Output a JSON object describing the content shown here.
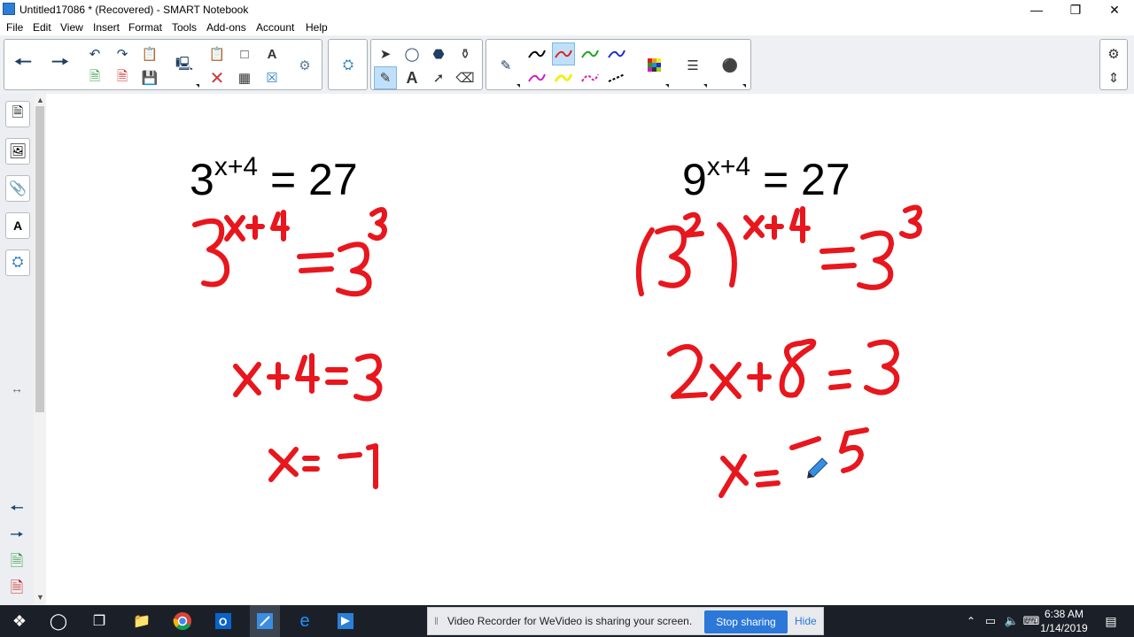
{
  "window": {
    "title": "Untitled17086 * (Recovered) - SMART Notebook",
    "minimize_icon": "minimize-icon",
    "restore_icon": "restore-icon",
    "close_icon": "close-icon"
  },
  "menu": [
    "File",
    "Edit",
    "View",
    "Insert",
    "Format",
    "Tools",
    "Add-ons",
    "Account",
    "Help"
  ],
  "toolbar": {
    "icons": [
      "back-arrow-icon",
      "forward-arrow-icon",
      "undo-icon",
      "redo-icon",
      "paste-page-icon",
      "add-page-icon",
      "delete-page-icon",
      "save-icon",
      "screen-capture-icon",
      "paste-icon",
      "delete-icon",
      "display-screen-icon",
      "table-icon",
      "spell-check-icon",
      "clear-icon",
      "addons-icon",
      "select-icon",
      "shapes-icon",
      "fill-icon",
      "eraser-icon",
      "text-icon",
      "line-icon",
      "pen-icon",
      "properties-icon",
      "settings-icon",
      "move-toolbar-icon"
    ],
    "pen_colors": [
      "#000000",
      "#e0211b",
      "#1aa31a",
      "#1e2bd6",
      "#d11bc8",
      "#f0f01a",
      "#e01aa0",
      "#000000"
    ]
  },
  "sidebar": {
    "tabs": [
      "page-sorter-icon",
      "gallery-icon",
      "attachments-icon",
      "properties-icon",
      "addons-icon"
    ]
  },
  "canvas": {
    "left_equation": {
      "base": "3",
      "exponent": "x+4",
      "rhs": "= 27"
    },
    "right_equation": {
      "base": "9",
      "exponent": "x+4",
      "rhs": "= 27"
    },
    "handwritten": {
      "left": [
        "3^(x+4) = 3^3",
        "x+4=3",
        "x= -1"
      ],
      "right": [
        "(3^2)^(x+4) = 3^3",
        "2x+8 = 3",
        "x= -5"
      ]
    },
    "ink_color": "#e8161d"
  },
  "taskbar": {
    "notification": "Video Recorder for WeVideo is sharing your screen.",
    "stop_label": "Stop sharing",
    "hide_label": "Hide",
    "time": "6:38 AM",
    "date": "1/14/2019"
  }
}
